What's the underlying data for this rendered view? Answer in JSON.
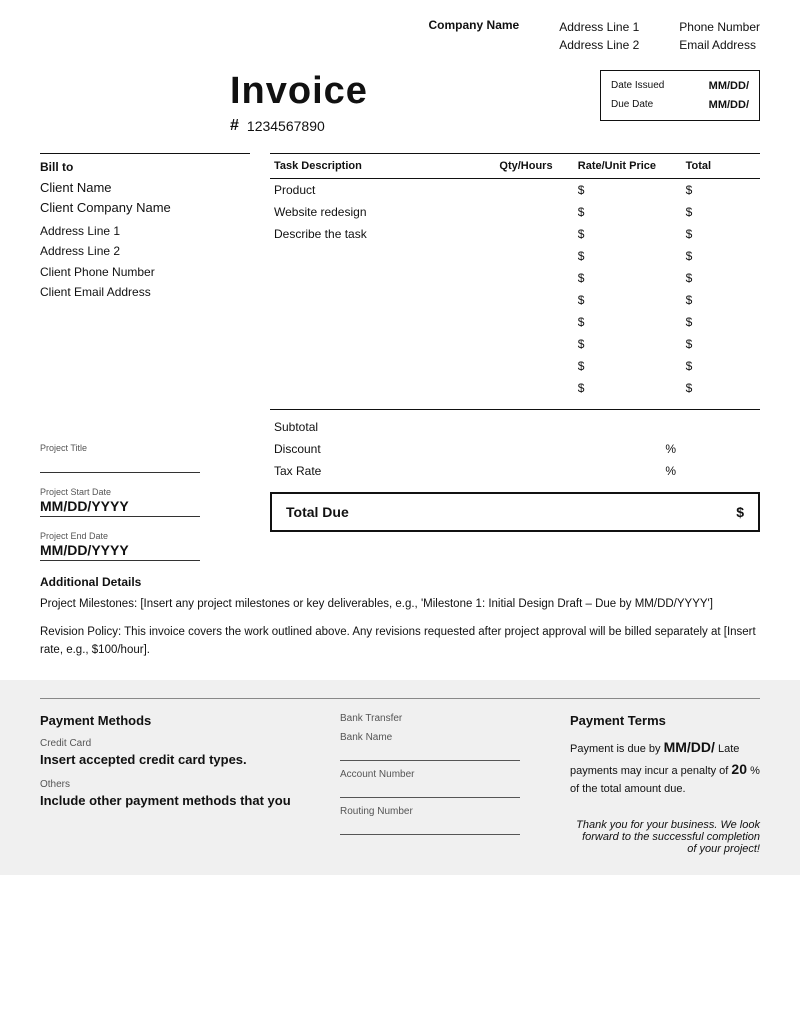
{
  "header": {
    "company_name": "Company Name",
    "address_line1": "Address Line 1",
    "address_line2": "Address Line 2",
    "phone_label": "Phone Number",
    "email_label": "Email Address"
  },
  "invoice": {
    "title": "Invoice",
    "number_label": "#",
    "number_value": "1234567890",
    "date_issued_label": "Date Issued",
    "due_date_label": "Due Date",
    "date_issued_value": "MM/DD/",
    "due_date_value": "MM/DD/"
  },
  "bill_to": {
    "label": "Bill to",
    "client_name": "Client Name",
    "client_company": "Client Company Name",
    "address_line1": "Address Line 1",
    "address_line2": "Address Line 2",
    "phone": "Client Phone Number",
    "email": "Client Email Address"
  },
  "project": {
    "title_label": "Project Title",
    "start_date_label": "Project Start Date",
    "start_date_value": "MM/DD/YYYY",
    "end_date_label": "Project End Date",
    "end_date_value": "MM/DD/YYYY"
  },
  "table": {
    "headers": {
      "description": "Task Description",
      "qty": "Qty/Hours",
      "rate": "Rate/Unit Price",
      "total": "Total"
    },
    "rows": [
      {
        "description": "Product",
        "qty": "",
        "rate": "$",
        "total": "$"
      },
      {
        "description": "Website redesign",
        "qty": "",
        "rate": "$",
        "total": "$"
      },
      {
        "description": "Describe the task",
        "qty": "",
        "rate": "$",
        "total": "$"
      },
      {
        "description": "",
        "qty": "",
        "rate": "$",
        "total": "$"
      },
      {
        "description": "",
        "qty": "",
        "rate": "$",
        "total": "$"
      },
      {
        "description": "",
        "qty": "",
        "rate": "$",
        "total": "$"
      },
      {
        "description": "",
        "qty": "",
        "rate": "$",
        "total": "$"
      },
      {
        "description": "",
        "qty": "",
        "rate": "$",
        "total": "$"
      },
      {
        "description": "",
        "qty": "",
        "rate": "$",
        "total": "$"
      },
      {
        "description": "",
        "qty": "",
        "rate": "$",
        "total": "$"
      }
    ],
    "subtotal_label": "Subtotal",
    "discount_label": "Discount",
    "discount_pct": "%",
    "tax_rate_label": "Tax Rate",
    "tax_rate_pct": "%",
    "total_due_label": "Total Due",
    "total_due_value": "$"
  },
  "additional": {
    "label": "Additional Details",
    "milestones_text": "Project Milestones: [Insert any project milestones or key deliverables, e.g., 'Milestone 1: Initial Design Draft – Due by MM/DD/YYYY']",
    "revision_text": "Revision Policy: This invoice covers the work outlined above. Any revisions requested after project approval will be billed separately at [Insert rate, e.g., $100/hour]."
  },
  "payment_methods": {
    "label": "Payment Methods",
    "credit_card_label": "Credit Card",
    "credit_card_value": "Insert accepted credit card types.",
    "others_label": "Others",
    "others_value": "Include other payment methods that you",
    "bank_transfer_label": "Bank Transfer",
    "bank_name_label": "Bank Name",
    "account_number_label": "Account Number",
    "routing_number_label": "Routing Number"
  },
  "payment_terms": {
    "label": "Payment Terms",
    "text_before": "Payment is due by",
    "due_date": "MM/DD/",
    "text_after": "Late payments may incur a penalty of",
    "penalty_pct": "20",
    "text_end": "% of the total amount due."
  },
  "thank_you": {
    "text": "Thank you for your business. We look forward to the successful completion of your project!"
  }
}
